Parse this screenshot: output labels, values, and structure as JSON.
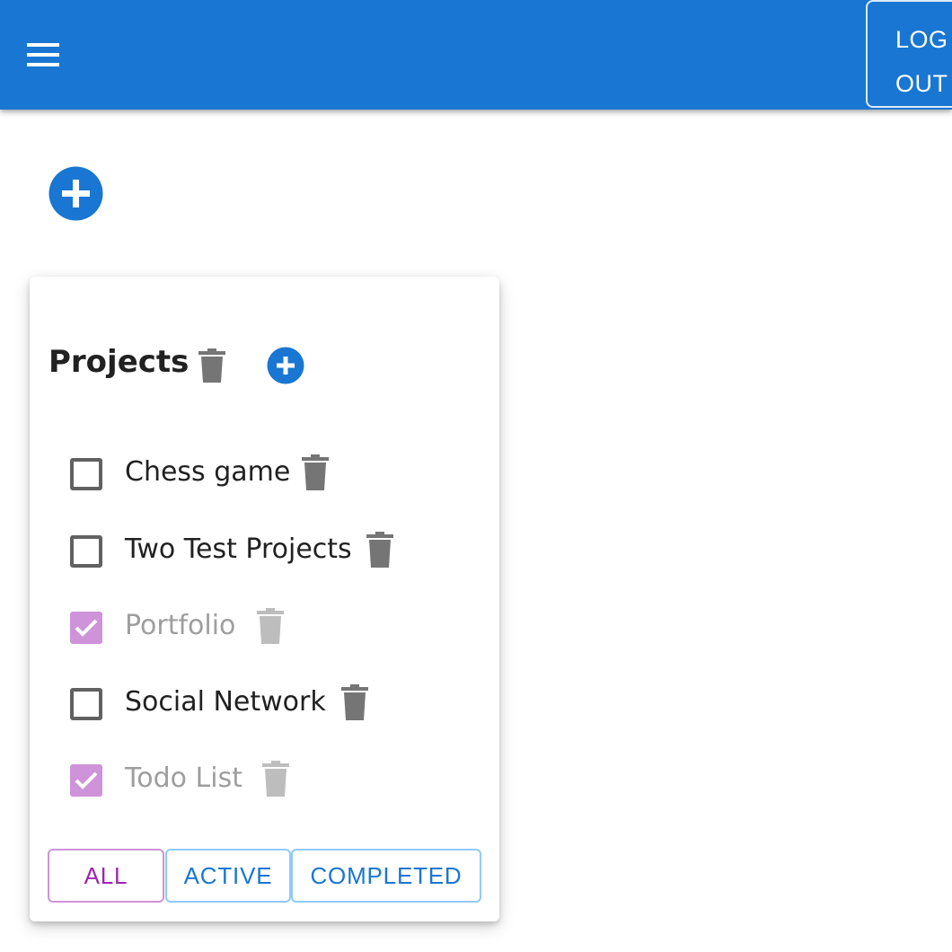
{
  "appbar": {
    "background": "#1976d2",
    "menu_icon": "menu-icon",
    "logout_line1": "LOG",
    "logout_line2": "OUT"
  },
  "add_project_icon": "add-circle-icon",
  "card": {
    "title": "Projects",
    "title_trash_icon": "trash-icon",
    "title_add_icon": "add-circle-icon",
    "items": [
      {
        "label": "Chess game",
        "completed": false
      },
      {
        "label": "Two Test Projects",
        "completed": false
      },
      {
        "label": "Portfolio",
        "completed": true
      },
      {
        "label": "Social Network",
        "completed": false
      },
      {
        "label": "Todo List",
        "completed": true
      }
    ],
    "filters": {
      "all": "ALL",
      "active": "ACTIVE",
      "completed": "COMPLETED",
      "selected": "ALL"
    }
  },
  "colors": {
    "primary": "#1976d2",
    "checked": "#ce93d8",
    "selected_filter": "#9c27b0",
    "icon_grey": "#757575",
    "icon_grey_disabled": "#bdbdbd"
  }
}
